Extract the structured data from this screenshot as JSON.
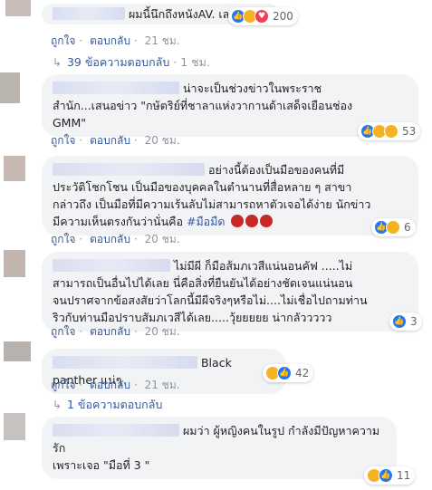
{
  "comments": [
    {
      "text": "ผมนี้นึกถึงหนังAV. เลย",
      "reactions_count": "200",
      "actions": {
        "like": "ถูกใจ",
        "reply": "ตอบกลับ",
        "time": "21 ชม."
      },
      "replies": {
        "label": "39 ข้อความตอบกลับ",
        "time": "1 ชม."
      }
    },
    {
      "lines": [
        "น่าจะเป็นช่วงข่าวในพระราช",
        "สำนัก...เสนอข่าว \"กษัตริย์ที่ชาลาแห่งวากานด้าเสด็จเยือนช่อง",
        "GMM\""
      ],
      "reactions_count": "53",
      "actions": {
        "like": "ถูกใจ",
        "reply": "ตอบกลับ",
        "time": "20 ชม."
      }
    },
    {
      "lines": [
        "อย่างนี้ต้องเป็นมือของคนที่มี",
        "ประวัติโชกโชน เป็นมือของบุคคลในตำนานที่สื่อหลาย ๆ สาขา",
        "กล่าวถึง เป็นมือที่มีความเร้นลับไม่สามารถหาตัวเจอได้ง่าย นักข่าว",
        "มีความเห็นตรงกันว่านั่นคือ"
      ],
      "hashtag": "#มือมืด",
      "reactions_count": "6",
      "actions": {
        "like": "ถูกใจ",
        "reply": "ตอบกลับ",
        "time": "20 ชม."
      }
    },
    {
      "lines": [
        "ไม่มีผี ก็มือส้มภเวสีแน่นอนคัฟ .....ไม่",
        "สามารถเป็นอื่นไปได้เลย นี่คือสิ่งที่ยืนยันได้อย่างชัดเจนแน่นอน",
        "จนปราศจากข้อสงสัยว่าโลกนี้มีผีจริงๆหรือไม่....ไม่เชื่อไปถามท่าน",
        "ริวกับท่านมือปราบสัมภเวสีได้เลย.....วุ้ยยยยย น่ากลัววววว"
      ],
      "reactions_count": "3",
      "actions": {
        "like": "ถูกใจ",
        "reply": "ตอบกลับ",
        "time": "20 ชม."
      }
    },
    {
      "text": "Black panther แน่ๆ",
      "reactions_count": "42",
      "actions": {
        "like": "ถูกใจ",
        "reply": "ตอบกลับ",
        "time": "21 ชม."
      },
      "replies": {
        "label": "1 ข้อความตอบกลับ"
      }
    },
    {
      "lines": [
        "ผมว่า ผู้หญิงคนในรูป กำลังมีปัญหาความ",
        "รัก",
        "เพราะเจอ \"มือที่ 3 \""
      ],
      "reactions_count": "11",
      "actions": {
        "like": "ถูกใจ",
        "reply": "ตอบกลับ",
        "time": "20 ชม."
      }
    }
  ],
  "colors": {
    "link": "#385898",
    "meta": "#90949c",
    "bubble": "#f2f3f5",
    "like": "#2078f4",
    "heart": "#f33e58",
    "emoji": "#f7b125"
  },
  "icons": {
    "reply_arrow": "reply-arrow-icon",
    "like": "like-icon",
    "heart": "heart-icon",
    "haha": "haha-icon",
    "wow": "wow-icon",
    "sad": "sad-icon",
    "devil": "devil-emoji-icon"
  }
}
